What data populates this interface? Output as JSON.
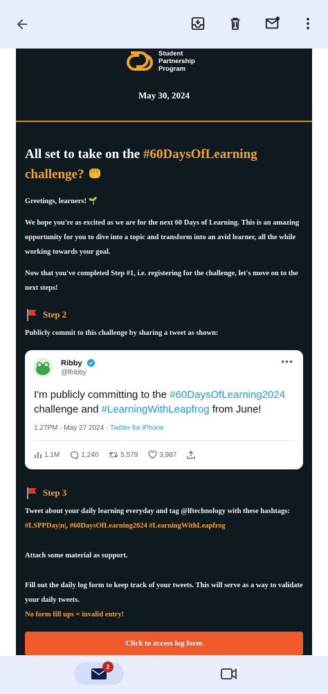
{
  "appbar": {
    "back_icon": "arrow-left-icon",
    "actions": [
      "archive-icon",
      "delete-icon",
      "mark-unread-icon",
      "more-vert-icon"
    ]
  },
  "email": {
    "brand": {
      "line1": "Student",
      "line2": "Partnership",
      "line3": "Program"
    },
    "date": "May 30, 2024",
    "heading_prefix": "All set to take on the ",
    "heading_hashtag": "#60DaysOfLearning",
    "heading_suffix": "challenge?",
    "greeting": "Greetings, learners! 🌱",
    "para1": "We hope you're as excited as we are for the next 60 Days of Learning. This is an amazing opportunity for you to dive into a topic and transform into an avid learner, all the while working towards your goal.",
    "para2": "Now that you've completed Step #1, i.e. registering for the challenge, let's move on to the next steps!",
    "step2_title": "Step 2",
    "step2_text": "Publicly commit to this challenge by sharing a tweet as shown:",
    "tweet": {
      "name": "Ribby",
      "handle": "@lfribby",
      "text_before": "I'm publicly committing to the ",
      "hashtag1": "#60DaysOfLearning2024",
      "text_middle": " challenge and ",
      "hashtag2": "#LearningWithLeapfrog",
      "text_after": " from June!",
      "time": "1:27PM · May 27 2024 · ",
      "source": "Twitter for iPhone",
      "views": "1.1M",
      "replies": "1,240",
      "retweets": "5,579",
      "likes": "3,987"
    },
    "step3_title": "Step 3",
    "step3_text_a": "Tweet about your daily learning everyday and tag @lftechnology with these hashtags: ",
    "step3_hashtags": "#LSPPDay|n|, #60DaysOfLearning2024 #LearningWithLeapfrog",
    "attach_text": "Attach some material as support.",
    "log_text": "Fill out the daily log form to keep track of your tweets. This will serve as a way to validate your daily tweets.",
    "warning": "No form fill ups = invalid entry!",
    "cta_label": "Click to access log form"
  },
  "bottomnav": {
    "mail_badge": "2",
    "mail_icon": "mail-icon",
    "video_icon": "video-icon"
  },
  "colors": {
    "accent": "#f2a32d",
    "cta": "#f15a2a",
    "email_bg": "#0e1a20",
    "twitter_blue": "#1d9bf0"
  }
}
